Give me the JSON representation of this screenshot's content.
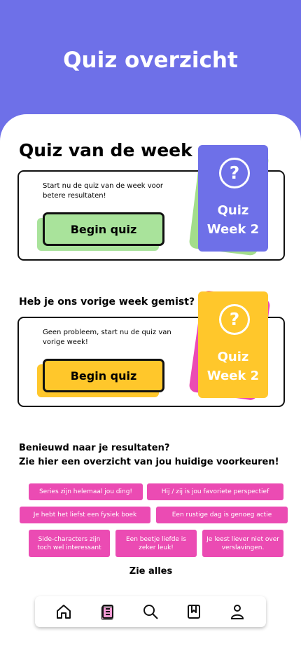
{
  "page": {
    "title": "Quiz overzicht"
  },
  "week_quiz": {
    "heading": "Quiz van de week",
    "description": "Start nu de quiz van de week voor betere resultaten!",
    "button": "Begin quiz",
    "card": {
      "icon": "question-circle-icon",
      "line1": "Quiz",
      "line2": "Week 2"
    },
    "colors": {
      "card": "#6E70E8",
      "back_card": "#A3DD8B",
      "button": "#A9E39B"
    }
  },
  "previous_quiz": {
    "heading": "Heb je ons vorige week gemist?",
    "description": "Geen probleem, start nu de quiz van vorige week!",
    "button": "Begin quiz",
    "card": {
      "icon": "question-circle-icon",
      "line1": "Quiz",
      "line2": "Week 2"
    },
    "colors": {
      "card": "#FFC72B",
      "back_card": "#EB4BB3",
      "button": "#FFC72B"
    }
  },
  "results": {
    "title_line1": "Benieuwd naar je resultaten?",
    "title_line2": "Zie hier een overzicht van jou huidige voorkeuren!",
    "chips": [
      "Series zijn helemaal jou ding!",
      "Hij / zij is jou favoriete perspectief",
      "Je hebt het liefst een fysiek boek",
      "Een rustige dag is genoeg actie",
      "Side-characters zijn toch wel interessant",
      "Een beetje liefde is zeker leuk!",
      "Je leest liever niet over verslavingen."
    ],
    "see_all": "Zie alles"
  },
  "nav": {
    "items": [
      "home-icon",
      "clipboard-list-icon",
      "search-icon",
      "bookmark-icon",
      "profile-icon"
    ]
  }
}
